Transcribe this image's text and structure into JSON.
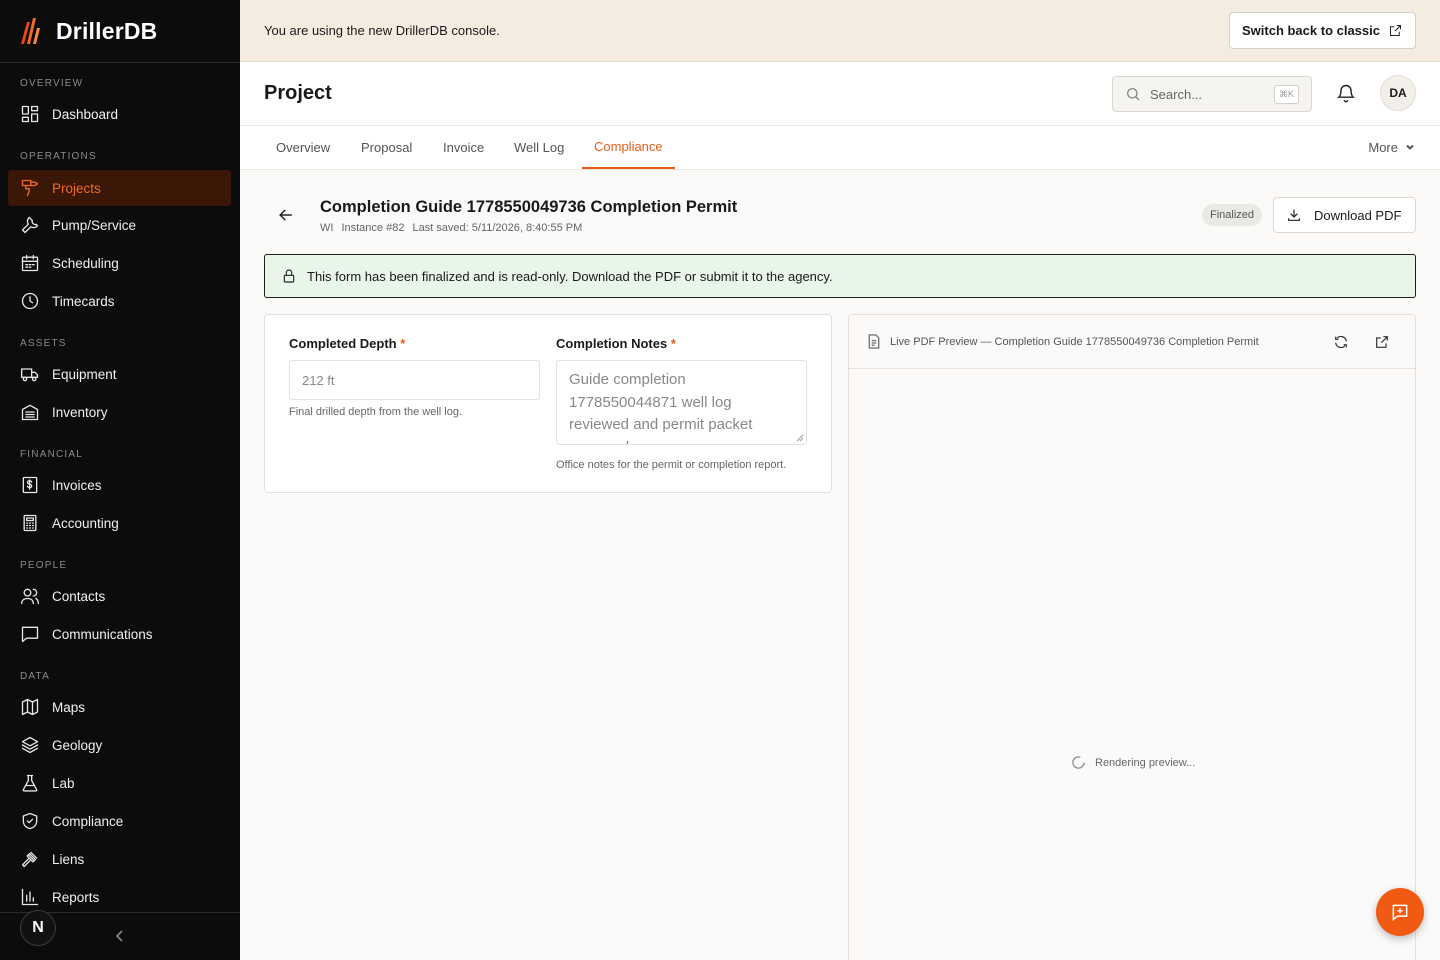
{
  "brand": {
    "name": "DrillerDB",
    "accent": "#e85d16"
  },
  "sidebar": {
    "sections": [
      {
        "title": "OVERVIEW",
        "items": [
          {
            "label": "Dashboard",
            "icon": "dashboard-icon"
          }
        ]
      },
      {
        "title": "OPERATIONS",
        "items": [
          {
            "label": "Projects",
            "icon": "drill-icon",
            "active": true
          },
          {
            "label": "Pump/Service",
            "icon": "wrench-icon"
          },
          {
            "label": "Scheduling",
            "icon": "calendar-icon"
          },
          {
            "label": "Timecards",
            "icon": "clock-icon"
          }
        ]
      },
      {
        "title": "ASSETS",
        "items": [
          {
            "label": "Equipment",
            "icon": "truck-icon"
          },
          {
            "label": "Inventory",
            "icon": "warehouse-icon"
          }
        ]
      },
      {
        "title": "FINANCIAL",
        "items": [
          {
            "label": "Invoices",
            "icon": "dollar-file-icon"
          },
          {
            "label": "Accounting",
            "icon": "calculator-icon"
          }
        ]
      },
      {
        "title": "PEOPLE",
        "items": [
          {
            "label": "Contacts",
            "icon": "users-icon"
          },
          {
            "label": "Communications",
            "icon": "message-icon"
          }
        ]
      },
      {
        "title": "DATA",
        "items": [
          {
            "label": "Maps",
            "icon": "map-icon"
          },
          {
            "label": "Geology",
            "icon": "layers-icon"
          },
          {
            "label": "Lab",
            "icon": "flask-icon"
          },
          {
            "label": "Compliance",
            "icon": "shield-check-icon"
          },
          {
            "label": "Liens",
            "icon": "gavel-icon"
          },
          {
            "label": "Reports",
            "icon": "bar-chart-icon"
          }
        ]
      }
    ],
    "footer_logo": "N"
  },
  "banner": {
    "message": "You are using the new DrillerDB console.",
    "button_label": "Switch back to classic"
  },
  "header": {
    "title": "Project",
    "search_placeholder": "Search...",
    "search_shortcut": "⌘K",
    "avatar_initials": "DA"
  },
  "tabs": {
    "items": [
      "Overview",
      "Proposal",
      "Invoice",
      "Well Log",
      "Compliance"
    ],
    "active_index": 4,
    "more_label": "More"
  },
  "document": {
    "title": "Completion Guide 1778550049736 Completion Permit",
    "state": "WI",
    "instance": "Instance #82",
    "last_saved": "Last saved: 5/11/2026, 8:40:55 PM",
    "status_badge": "Finalized",
    "download_label": "Download PDF"
  },
  "alert": {
    "message": "This form has been finalized and is read-only. Download the PDF or submit it to the agency."
  },
  "form": {
    "completed_depth": {
      "label": "Completed Depth",
      "required_mark": "*",
      "value": "212 ft",
      "help": "Final drilled depth from the well log."
    },
    "completion_notes": {
      "label": "Completion Notes",
      "required_mark": "*",
      "value": "Guide completion 1778550044871 well log reviewed and permit packet prepared.",
      "help": "Office notes for the permit or completion report."
    }
  },
  "preview": {
    "title": "Live PDF Preview — Completion Guide 1778550049736 Completion Permit",
    "status": "Rendering preview..."
  }
}
